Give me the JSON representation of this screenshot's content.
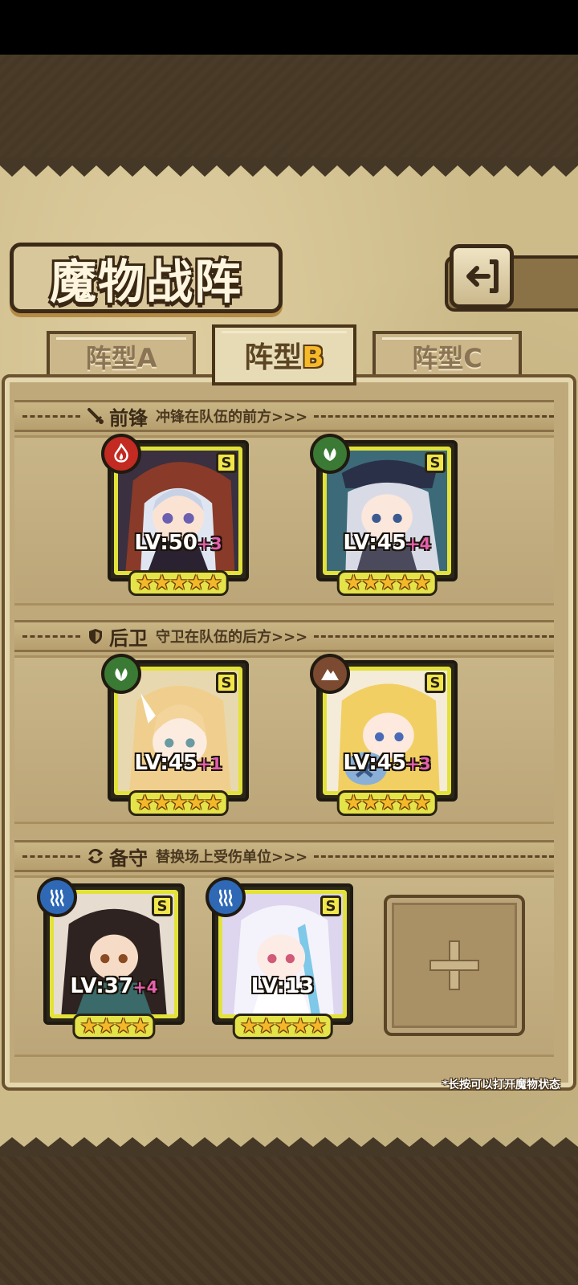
{
  "title": "魔物战阵",
  "back_icon": "return-arrow-icon",
  "tabs": [
    {
      "prefix": "阵型",
      "letter": "A",
      "active": false
    },
    {
      "prefix": "阵型",
      "letter": "B",
      "active": true
    },
    {
      "prefix": "阵型",
      "letter": "C",
      "active": false
    }
  ],
  "sections": {
    "front": {
      "title": "前锋",
      "desc": "冲锋在队伍的前方>>>",
      "icon": "sword-icon"
    },
    "rear": {
      "title": "后卫",
      "desc": "守卫在队伍的后方>>>",
      "icon": "shield-icon"
    },
    "reserve": {
      "title": "备守",
      "desc": "替换场上受伤单位>>>",
      "icon": "swap-icon"
    }
  },
  "monsters": {
    "front_1": {
      "element": "fire",
      "rank": "S",
      "level": "LV:50",
      "plus": "+3",
      "stars": "★★★★★"
    },
    "front_2": {
      "element": "leaf",
      "rank": "S",
      "level": "LV:45",
      "plus": "+4",
      "stars": "★★★★★"
    },
    "rear_1": {
      "element": "leaf",
      "rank": "S",
      "level": "LV:45",
      "plus": "+1",
      "stars": "★★★★★"
    },
    "rear_2": {
      "element": "earth",
      "rank": "S",
      "level": "LV:45",
      "plus": "+3",
      "stars": "★★★★★"
    },
    "reserve_1": {
      "element": "water",
      "rank": "S",
      "level": "LV:37",
      "plus": "+4",
      "stars": "★★★★"
    },
    "reserve_2": {
      "element": "water",
      "rank": "S",
      "level": "LV:13",
      "plus": "",
      "stars": "★★★★★"
    }
  },
  "empty_slot_icon": "plus-icon",
  "hint": "*长按可以打开魔物状态",
  "colors": {
    "parchment": "#cdbb8a",
    "frame": "#3c2a18",
    "card_border": "#e2e23a",
    "star": "#f2b82a",
    "plus_level": "#e65fae"
  }
}
